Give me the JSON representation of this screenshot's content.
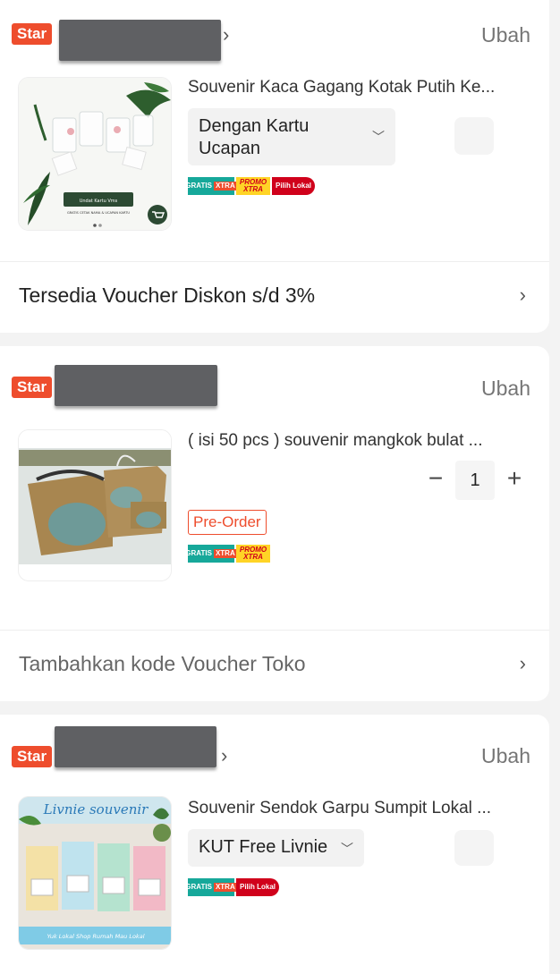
{
  "colors": {
    "accent": "#ee4d2d",
    "redacted": "#5f6063"
  },
  "shops": [
    {
      "badge": "Star",
      "edit_label": "Ubah",
      "product": {
        "title": "Souvenir Kaca Gagang Kotak Putih Ke...",
        "variant": "Dengan Kartu Ucapan",
        "tags": [
          "GRATIS ONGKIR XTRA",
          "PROMO XTRA",
          "Pilih Lokal"
        ],
        "thumb_caption": "Undat Kartu Vms",
        "thumb_sub": "GRATIS CETAK NAMA & UCAPAN KARTU"
      },
      "voucher": "Tersedia Voucher Diskon s/d 3%"
    },
    {
      "badge": "Star",
      "edit_label": "Ubah",
      "product": {
        "title": "( isi 50 pcs ) souvenir mangkok bulat ...",
        "quantity": "1",
        "preorder": "Pre-Order",
        "tags": [
          "GRATIS ONGKIR XTRA",
          "PROMO XTRA"
        ]
      },
      "voucher": "Tambahkan kode Voucher Toko"
    },
    {
      "badge": "Star",
      "edit_label": "Ubah",
      "product": {
        "title": "Souvenir Sendok Garpu Sumpit Lokal ...",
        "variant": "KUT Free Livnie",
        "tags": [
          "GRATIS ONGKIR XTRA",
          "Pilih Lokal"
        ],
        "thumb_logo": "Livnie souvenir",
        "thumb_footer": "Yuk Lokal Shop Rumah Mau Lokal"
      }
    }
  ]
}
